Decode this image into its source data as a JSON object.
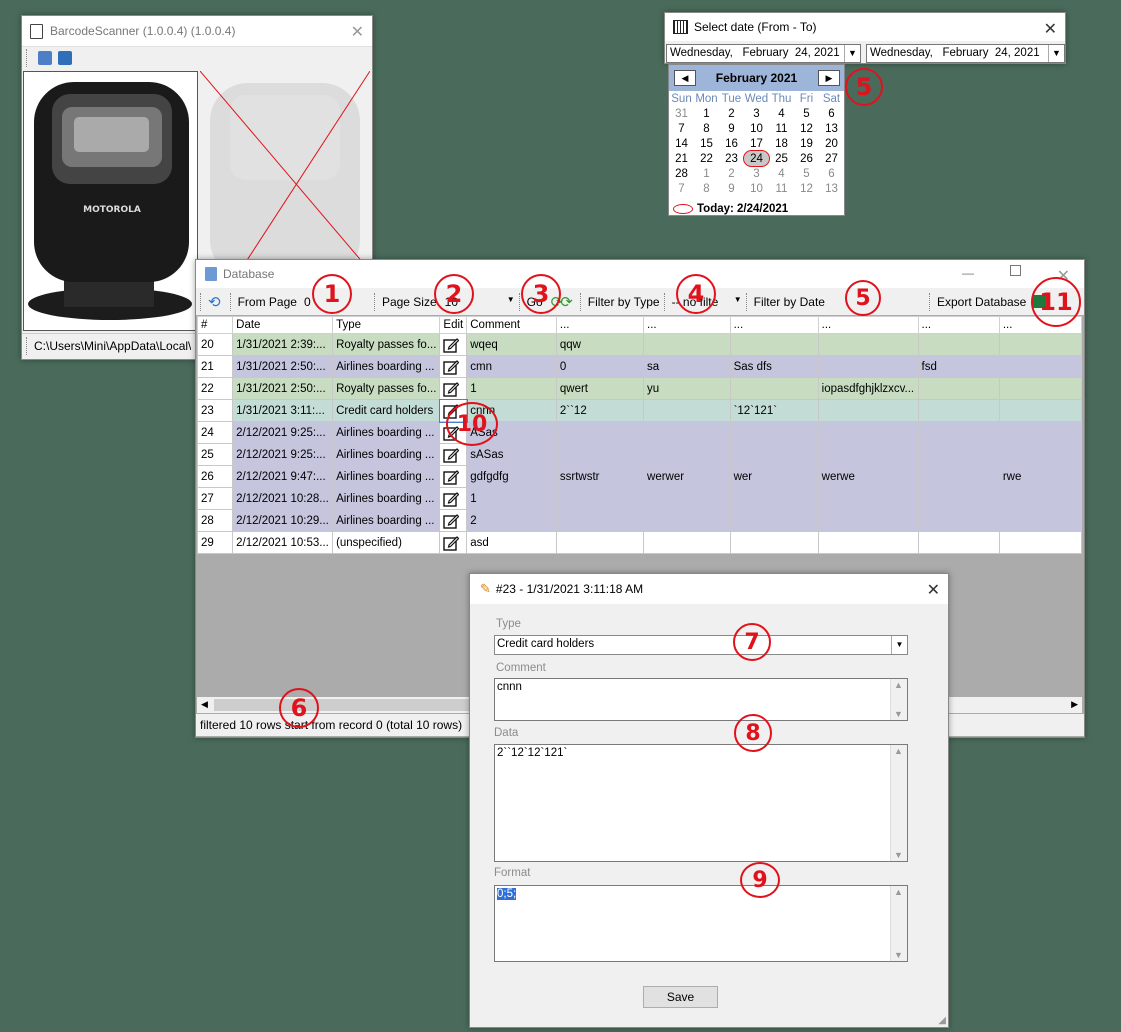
{
  "barcode_window": {
    "title": "BarcodeScanner (1.0.0.4) (1.0.0.4)",
    "path": "C:\\Users\\Mini\\AppData\\Local\\",
    "device_brand": "MOTOROLA"
  },
  "date_window": {
    "title": "Select date (From - To)",
    "from_value": "Wednesday,   February  24, 2021",
    "to_value": "Wednesday,   February  24, 2021",
    "month_label": "February 2021",
    "weekdays": [
      "Sun",
      "Mon",
      "Tue",
      "Wed",
      "Thu",
      "Fri",
      "Sat"
    ],
    "weeks": [
      [
        "31",
        "1",
        "2",
        "3",
        "4",
        "5",
        "6"
      ],
      [
        "7",
        "8",
        "9",
        "10",
        "11",
        "12",
        "13"
      ],
      [
        "14",
        "15",
        "16",
        "17",
        "18",
        "19",
        "20"
      ],
      [
        "21",
        "22",
        "23",
        "24",
        "25",
        "26",
        "27"
      ],
      [
        "28",
        "1",
        "2",
        "3",
        "4",
        "5",
        "6"
      ],
      [
        "7",
        "8",
        "9",
        "10",
        "11",
        "12",
        "13"
      ]
    ],
    "today_label": "Today: 2/24/2021"
  },
  "database_window": {
    "title": "Database",
    "toolbar": {
      "from_page_label": "From Page",
      "from_page_value": "0",
      "page_size_label": "Page Size",
      "page_size_value": "10",
      "go_label": "Go",
      "filter_type_label": "Filter by Type",
      "filter_type_value": "-- no filte",
      "filter_date_label": "Filter by Date",
      "export_label": "Export Database"
    },
    "columns": [
      "#",
      "Date",
      "Type",
      "Edit",
      "Comment",
      "...",
      "...",
      "...",
      "...",
      "...",
      "..."
    ],
    "rows": [
      {
        "idx": "20",
        "date": "1/31/2021 2:39:...",
        "type": "Royalty passes fo...",
        "comment": "wqeq",
        "c1": "qqw",
        "c2": "",
        "c3": "",
        "c4": "",
        "c5": "",
        "c6": ""
      },
      {
        "idx": "21",
        "date": "1/31/2021 2:50:...",
        "type": "Airlines boarding ...",
        "comment": "cmn",
        "c1": "0",
        "c2": "sa",
        "c3": "Sas dfs",
        "c4": "",
        "c5": "fsd",
        "c6": ""
      },
      {
        "idx": "22",
        "date": "1/31/2021 2:50:...",
        "type": "Royalty passes fo...",
        "comment": "1",
        "c1": "qwert",
        "c2": "yu",
        "c3": "",
        "c4": "iopasdfghjklzxcv...",
        "c5": "",
        "c6": ""
      },
      {
        "idx": "23",
        "date": "1/31/2021 3:11:...",
        "type": "Credit card holders",
        "comment": "cnnn",
        "c1": "2``12",
        "c2": "",
        "c3": "`12`121`",
        "c4": "",
        "c5": "",
        "c6": ""
      },
      {
        "idx": "24",
        "date": "2/12/2021 9:25:...",
        "type": "Airlines boarding ...",
        "comment": "ASas",
        "c1": "",
        "c2": "",
        "c3": "",
        "c4": "",
        "c5": "",
        "c6": ""
      },
      {
        "idx": "25",
        "date": "2/12/2021 9:25:...",
        "type": "Airlines boarding ...",
        "comment": "sASas",
        "c1": "",
        "c2": "",
        "c3": "",
        "c4": "",
        "c5": "",
        "c6": ""
      },
      {
        "idx": "26",
        "date": "2/12/2021 9:47:...",
        "type": "Airlines boarding ...",
        "comment": "gdfgdfg",
        "c1": "ssrtwstr",
        "c2": "werwer",
        "c3": "wer",
        "c4": "werwe",
        "c5": "",
        "c6": "rwe"
      },
      {
        "idx": "27",
        "date": "2/12/2021 10:28...",
        "type": "Airlines boarding ...",
        "comment": "1",
        "c1": "",
        "c2": "",
        "c3": "",
        "c4": "",
        "c5": "",
        "c6": ""
      },
      {
        "idx": "28",
        "date": "2/12/2021 10:29...",
        "type": "Airlines boarding ...",
        "comment": "2",
        "c1": "",
        "c2": "",
        "c3": "",
        "c4": "",
        "c5": "",
        "c6": ""
      },
      {
        "idx": "29",
        "date": "2/12/2021 10:53...",
        "type": "(unspecified)",
        "comment": "asd",
        "c1": "",
        "c2": "",
        "c3": "",
        "c4": "",
        "c5": "",
        "c6": ""
      }
    ],
    "status": "filtered 10 rows start from record 0 (total 10 rows)"
  },
  "edit_window": {
    "title": "#23 - 1/31/2021 3:11:18 AM",
    "type_label": "Type",
    "type_value": "Credit card holders",
    "comment_label": "Comment",
    "comment_value": "cnnn",
    "data_label": "Data",
    "data_value": "2``12`12`121`",
    "format_label": "Format",
    "format_value": "0;5;",
    "save_label": "Save"
  },
  "annotations": {
    "n1": "1",
    "n2": "2",
    "n3": "3",
    "n4": "4",
    "n5a": "5",
    "n5b": "5",
    "n6": "6",
    "n7": "7",
    "n8": "8",
    "n9": "9",
    "n10": "10",
    "n11": "11"
  },
  "colors": {
    "desktop": "#4a6b5b",
    "row_green": "#c7dcc0",
    "row_purple": "#c5c6dd",
    "row_teal": "#c4dcd6",
    "calendar_header": "#9db5d8",
    "annotation_red": "#e0121b"
  }
}
